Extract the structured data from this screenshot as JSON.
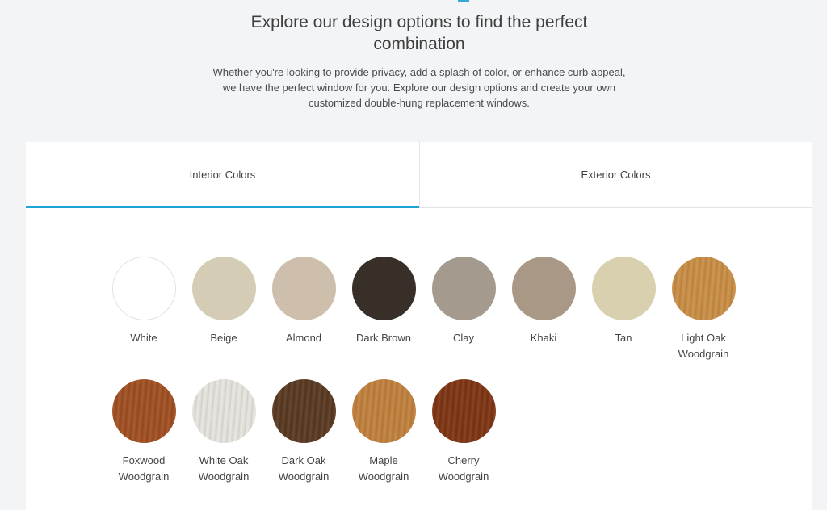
{
  "header": {
    "title": "Explore our design options to find the perfect combination",
    "description": "Whether you're looking to provide privacy, add a splash of color, or enhance curb appeal, we have the perfect window for you. Explore our design options and create your own customized double-hung replacement windows."
  },
  "tabs": {
    "interior": "Interior Colors",
    "exterior": "Exterior Colors",
    "active": "interior",
    "accent_color": "#1fa3d6"
  },
  "swatches": [
    {
      "label_1": "White",
      "label_2": "",
      "color": "#ffffff"
    },
    {
      "label_1": "Beige",
      "label_2": "",
      "color": "#d4ccb5"
    },
    {
      "label_1": "Almond",
      "label_2": "",
      "color": "#cdbfab"
    },
    {
      "label_1": "Dark Brown",
      "label_2": "",
      "color": "#372f28"
    },
    {
      "label_1": "Clay",
      "label_2": "",
      "color": "#a49a8d"
    },
    {
      "label_1": "Khaki",
      "label_2": "",
      "color": "#a99886"
    },
    {
      "label_1": "Tan",
      "label_2": "",
      "color": "#d9d0b0"
    },
    {
      "label_1": "Light Oak",
      "label_2": "Woodgrain",
      "color": "#c98d45"
    },
    {
      "label_1": "Foxwood",
      "label_2": "Woodgrain",
      "color": "#a04f22"
    },
    {
      "label_1": "White Oak",
      "label_2": "Woodgrain",
      "color": "#e6e3de"
    },
    {
      "label_1": "Dark Oak",
      "label_2": "Woodgrain",
      "color": "#5a3a22"
    },
    {
      "label_1": "Maple",
      "label_2": "Woodgrain",
      "color": "#c0803d"
    },
    {
      "label_1": "Cherry",
      "label_2": "Woodgrain",
      "color": "#7e3514"
    }
  ]
}
